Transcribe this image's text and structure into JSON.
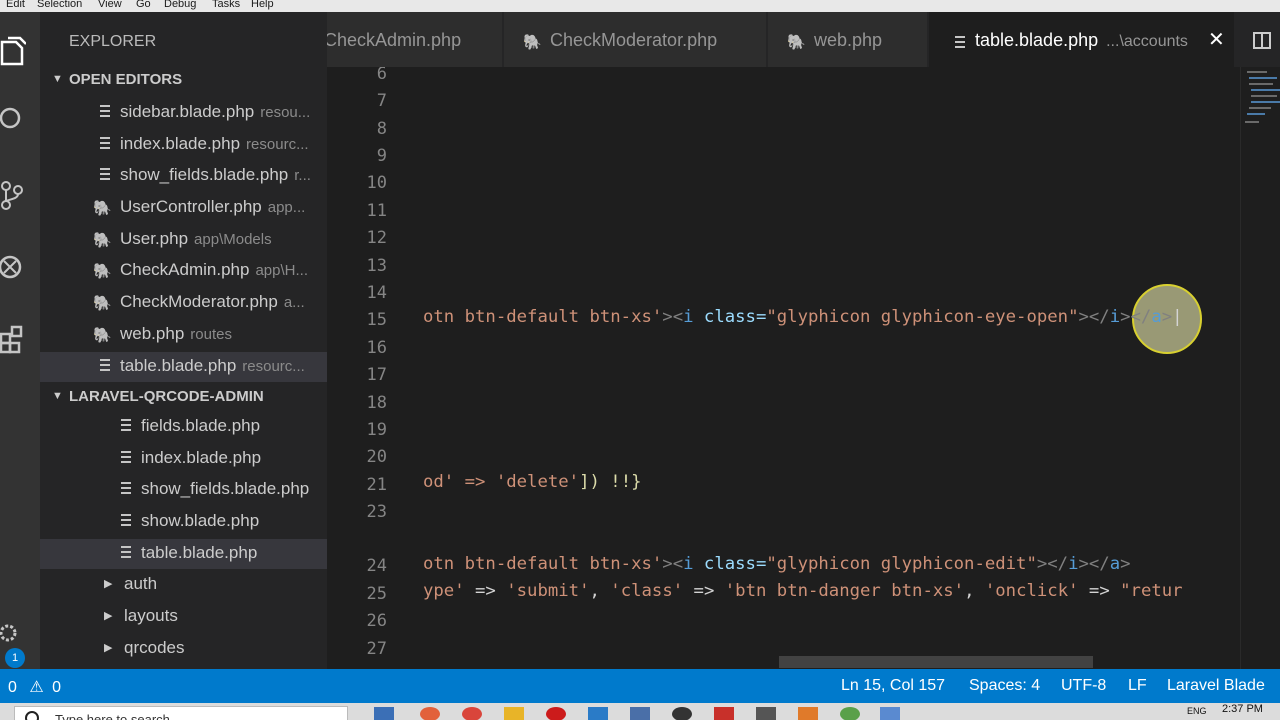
{
  "menu": [
    "Edit",
    "Selection",
    "View",
    "Go",
    "Debug",
    "Tasks",
    "Help"
  ],
  "explorer": {
    "title": "EXPLORER",
    "open_editors": {
      "header": "OPEN EDITORS",
      "items": [
        {
          "name": "sidebar.blade.php",
          "desc": "resou...",
          "icon": "lines-icon"
        },
        {
          "name": "index.blade.php",
          "desc": "resourc...",
          "icon": "lines-icon"
        },
        {
          "name": "show_fields.blade.php",
          "desc": "r...",
          "icon": "lines-icon"
        },
        {
          "name": "UserController.php",
          "desc": "app...",
          "icon": "php-elephant-icon"
        },
        {
          "name": "User.php",
          "desc": "app\\Models",
          "icon": "php-elephant-icon"
        },
        {
          "name": "CheckAdmin.php",
          "desc": "app\\H...",
          "icon": "php-elephant-icon"
        },
        {
          "name": "CheckModerator.php",
          "desc": "a...",
          "icon": "php-elephant-icon"
        },
        {
          "name": "web.php",
          "desc": "routes",
          "icon": "php-elephant-icon"
        },
        {
          "name": "table.blade.php",
          "desc": "resourc...",
          "icon": "lines-icon"
        }
      ]
    },
    "project": {
      "header": "LARAVEL-QRCODE-ADMIN",
      "files": [
        "fields.blade.php",
        "index.blade.php",
        "show_fields.blade.php",
        "show.blade.php",
        "table.blade.php"
      ],
      "folders": [
        "auth",
        "layouts",
        "qrcodes"
      ]
    }
  },
  "tabs": [
    {
      "label": "CheckAdmin.php",
      "icon": "php-elephant-icon"
    },
    {
      "label": "CheckModerator.php",
      "icon": "php-elephant-icon"
    },
    {
      "label": "web.php",
      "icon": "php-elephant-icon"
    },
    {
      "label": "table.blade.php",
      "desc": "...\\accounts",
      "icon": "lines-icon",
      "close": "✕"
    }
  ],
  "editor": {
    "line_numbers": [
      "6",
      "7",
      "8",
      "9",
      "10",
      "11",
      "12",
      "13",
      "14",
      "15",
      "16",
      "17",
      "18",
      "19",
      "20",
      "21",
      "23",
      "24",
      "25",
      "26",
      "27"
    ],
    "line15": {
      "a": "otn btn-default btn-xs'",
      "b": "><",
      "c": "i",
      "d": " class=",
      "e": "\"glyphicon glyphicon-eye-open\"",
      "f": "></",
      "g": "i",
      "h": "></",
      "i": "a",
      "j": ">"
    },
    "line21": {
      "a": "od' => ",
      "b": "'delete'",
      "c": "]) !!}"
    },
    "line24": {
      "a": "otn btn-default btn-xs'",
      "b": "><",
      "c": "i",
      "d": " class=",
      "e": "\"glyphicon glyphicon-edit\"",
      "f": "></",
      "g": "i",
      "h": "></",
      "i": "a",
      "j": ">"
    },
    "line25": {
      "a": "ype'",
      "b": " => ",
      "c": "'submit'",
      "d": ", ",
      "e": "'class'",
      "f": " => ",
      "g": "'btn btn-danger btn-xs'",
      "h": ", ",
      "i": "'onclick'",
      "j": " => ",
      "k": "\"retur"
    }
  },
  "status": {
    "errors": "0",
    "warnings": "0",
    "position": "Ln 15, Col 157",
    "spaces": "Spaces: 4",
    "encoding": "UTF-8",
    "eol": "LF",
    "language": "Laravel Blade",
    "badge": "1"
  },
  "taskbar": {
    "search_placeholder": "Type here to search",
    "clock": "2:37 PM",
    "lang": "ENG"
  },
  "colors": {
    "accent": "#007acc",
    "php": "#a074c4",
    "string": "#ce9178",
    "attr": "#9cdcfe",
    "tag": "#569cd6"
  }
}
